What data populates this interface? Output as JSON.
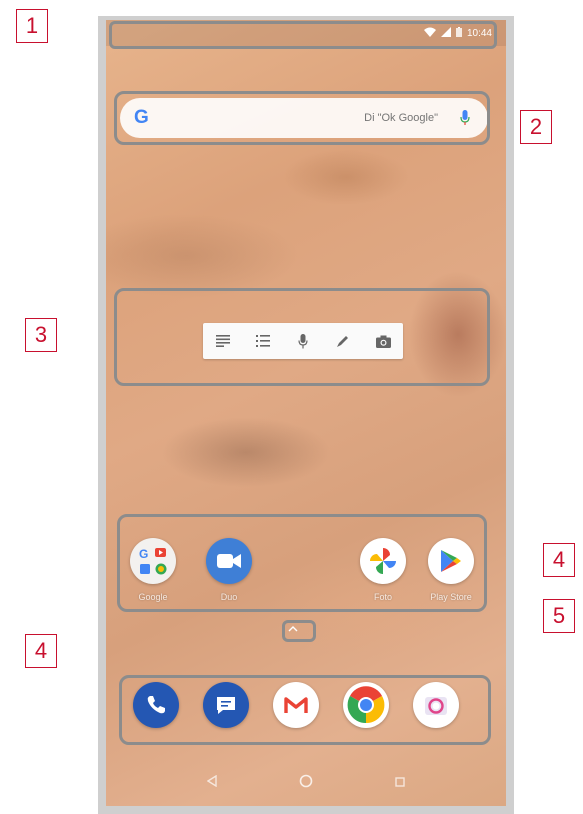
{
  "status_bar": {
    "time": "10:44",
    "icons": [
      "wifi-icon",
      "signal-icon",
      "battery-icon"
    ]
  },
  "search_widget": {
    "logo": "G",
    "hint": "Di \"Ok Google\"",
    "mic_icon": "mic-icon"
  },
  "keep_widget": {
    "tools": [
      "text-note-icon",
      "list-note-icon",
      "audio-note-icon",
      "drawing-note-icon",
      "camera-note-icon"
    ]
  },
  "apps_row": [
    {
      "label": "Google",
      "icon": "google-folder-icon"
    },
    {
      "label": "Duo",
      "icon": "duo-icon"
    },
    {
      "label": "Foto",
      "icon": "photos-icon"
    },
    {
      "label": "Play Store",
      "icon": "play-store-icon"
    }
  ],
  "dock": [
    {
      "icon": "phone-icon"
    },
    {
      "icon": "messages-icon"
    },
    {
      "icon": "gmail-icon"
    },
    {
      "icon": "chrome-icon"
    },
    {
      "icon": "camera-icon"
    }
  ],
  "nav_bar": [
    "back-icon",
    "home-icon",
    "recents-icon"
  ],
  "callouts": [
    "1",
    "2",
    "3",
    "4",
    "5",
    "4"
  ],
  "colors": {
    "callout": "#c8102e",
    "highlight_box": "#8c8c8c",
    "google_blue": "#4285f4"
  }
}
